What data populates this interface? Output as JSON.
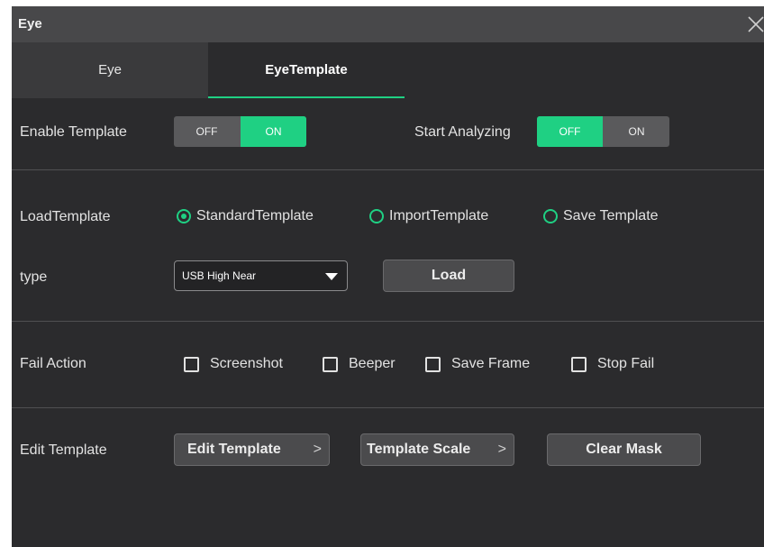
{
  "window": {
    "title": "Eye",
    "close_icon": "close-icon"
  },
  "tabs": [
    {
      "label": "Eye",
      "active": false
    },
    {
      "label": "EyeTemplate",
      "active": true
    }
  ],
  "accent_color": "#1fd083",
  "enable_template": {
    "label": "Enable Template",
    "off": "OFF",
    "on": "ON",
    "value": "ON"
  },
  "start_analyzing": {
    "label": "Start Analyzing",
    "off": "OFF",
    "on": "ON",
    "value": "OFF"
  },
  "load_template": {
    "label": "LoadTemplate",
    "options": [
      "StandardTemplate",
      "ImportTemplate",
      "Save Template"
    ],
    "selected": "StandardTemplate"
  },
  "type": {
    "label": "type",
    "value": "USB High Near",
    "load_label": "Load"
  },
  "fail_action": {
    "label": "Fail Action",
    "options": [
      {
        "label": "Screenshot",
        "checked": false
      },
      {
        "label": "Beeper",
        "checked": false
      },
      {
        "label": "Save Frame",
        "checked": false
      },
      {
        "label": "Stop Fail",
        "checked": false
      }
    ]
  },
  "edit_template": {
    "label": "Edit Template",
    "edit_button": "Edit Template",
    "scale_button": "Template Scale",
    "chevron": ">",
    "clear_button": "Clear Mask"
  }
}
